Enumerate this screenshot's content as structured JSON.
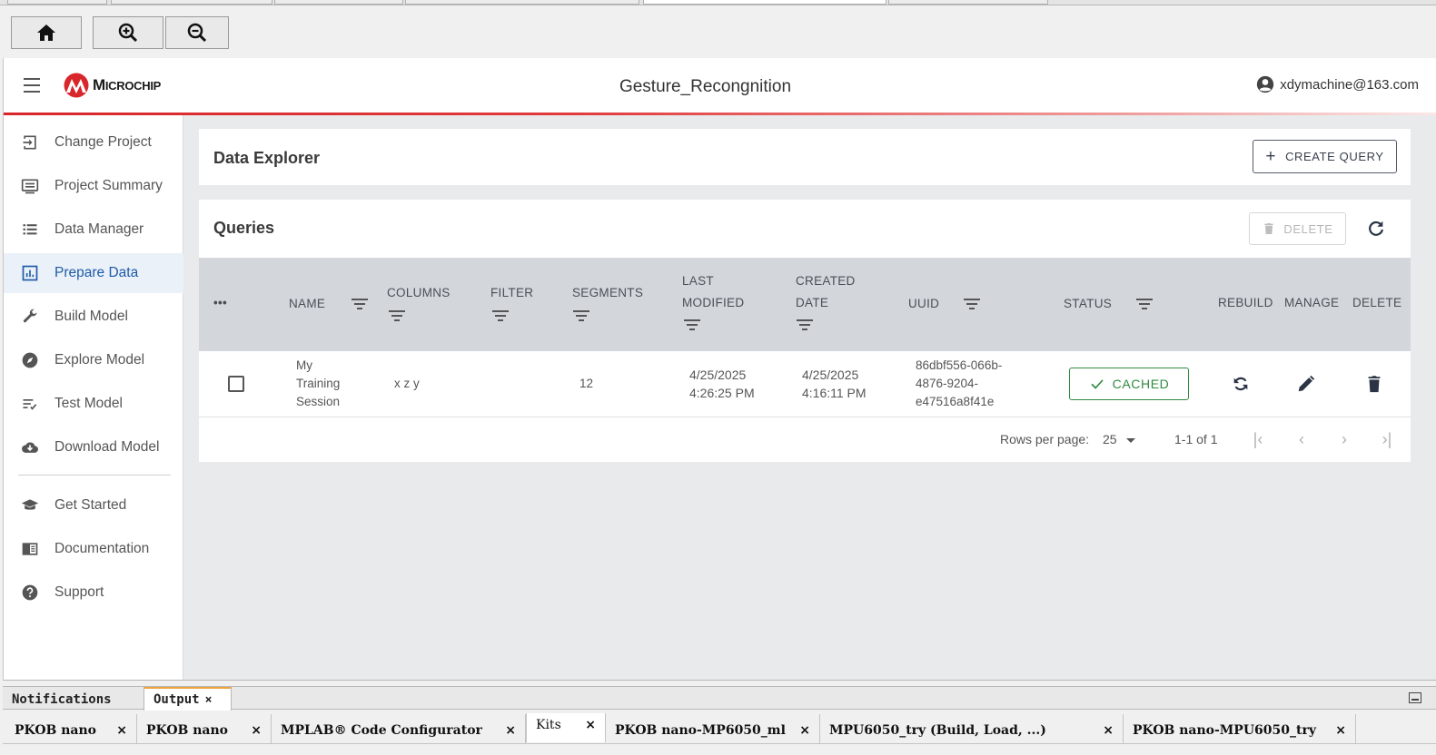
{
  "toolbar": {
    "home_icon": "home-icon",
    "zoom_in_icon": "zoom-in-icon",
    "zoom_out_icon": "zoom-out-icon"
  },
  "header": {
    "logo_text_main": "M",
    "logo_text_rest": "ICROCHIP",
    "project_title": "Gesture_Recongnition",
    "user_email": "xdymachine@163.com"
  },
  "sidebar": {
    "items": [
      {
        "label": "Change Project",
        "icon": "change-project-icon"
      },
      {
        "label": "Project Summary",
        "icon": "project-summary-icon"
      },
      {
        "label": "Data Manager",
        "icon": "data-manager-icon"
      },
      {
        "label": "Prepare Data",
        "icon": "prepare-data-icon",
        "active": true
      },
      {
        "label": "Build Model",
        "icon": "wrench-icon"
      },
      {
        "label": "Explore Model",
        "icon": "compass-icon"
      },
      {
        "label": "Test Model",
        "icon": "test-list-icon"
      },
      {
        "label": "Download Model",
        "icon": "cloud-download-icon"
      },
      {
        "label": "Get Started",
        "icon": "graduation-cap-icon"
      },
      {
        "label": "Documentation",
        "icon": "book-icon"
      },
      {
        "label": "Support",
        "icon": "help-icon"
      }
    ]
  },
  "explorer": {
    "title": "Data Explorer",
    "create_query_label": "CREATE QUERY"
  },
  "queries": {
    "title": "Queries",
    "delete_label": "DELETE",
    "columns": {
      "more": "•••",
      "name": "NAME",
      "columns": "COLUMNS",
      "filter": "FILTER",
      "segments": "SEGMENTS",
      "last_modified_1": "LAST",
      "last_modified_2": "MODIFIED",
      "created_1": "CREATED",
      "created_2": "DATE",
      "uuid": "UUID",
      "status": "STATUS",
      "rebuild": "REBUILD",
      "manage": "MANAGE",
      "delete": "DELETE"
    },
    "rows": [
      {
        "name_1": "My",
        "name_2": "Training",
        "name_3": "Session",
        "columns": "x z y",
        "filter": "",
        "segments": "12",
        "last_modified_1": "4/25/2025",
        "last_modified_2": "4:26:25 PM",
        "created_1": "4/25/2025",
        "created_2": "4:16:11 PM",
        "uuid_1": "86dbf556-066b-",
        "uuid_2": "4876-9204-",
        "uuid_3": "e47516a8f41e",
        "status": "CACHED"
      }
    ],
    "pagination": {
      "rows_per_page_label": "Rows per page:",
      "rows_per_page": "25",
      "range": "1-1 of 1"
    }
  },
  "bottom_panels": {
    "tabs": [
      {
        "label": "Notifications"
      },
      {
        "label": "Output",
        "active": true
      }
    ],
    "output_tabs": [
      {
        "label": "PKOB nano"
      },
      {
        "label": "PKOB nano"
      },
      {
        "label": "MPLAB® Code Configurator"
      },
      {
        "label": "Kits",
        "active": true
      },
      {
        "label": "PKOB nano-MP6050_ml"
      },
      {
        "label": "MPU6050_try (Build, Load, ...)"
      },
      {
        "label": "PKOB nano-MPU6050_try"
      }
    ],
    "close_glyph": "×"
  },
  "colors": {
    "accent_red": "#d8262b",
    "status_green": "#2e8b3e",
    "table_header_bg": "#d3d7dc"
  }
}
